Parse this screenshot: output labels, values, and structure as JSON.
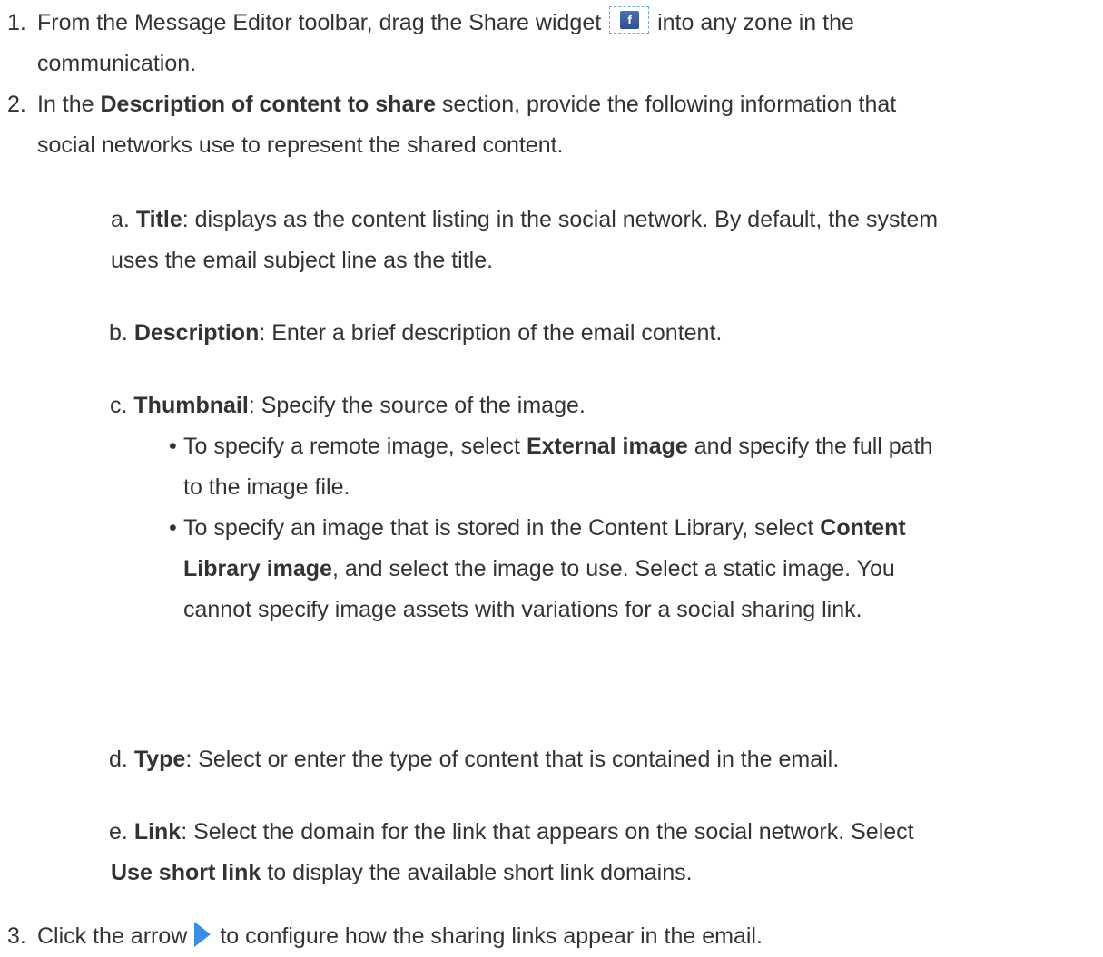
{
  "steps": [
    {
      "num": "1.",
      "pre": "From the Message Editor toolbar, drag the Share widget",
      "icon": "facebook-share-icon",
      "post": "into any zone in the",
      "line2": "communication."
    },
    {
      "num": "2.",
      "pre": "In the ",
      "bold": "Description of content to share",
      "post": " section, provide the following information that",
      "line2": "social networks use to represent the shared content."
    },
    {
      "num": "3.",
      "pre": "Click the arrow",
      "icon": "blue-arrow-icon",
      "post": "to configure how the sharing links appear in the email."
    }
  ],
  "subitems": [
    {
      "letter": "a.",
      "bold": "Title",
      "text": ": displays as the content listing in the social network. By default, the system",
      "line2": "uses the email subject line as the title."
    },
    {
      "letter": "b.",
      "bold": "Description",
      "text": ": Enter a brief description of the email content."
    },
    {
      "letter": "c.",
      "bold": "Thumbnail",
      "text": ": Specify the source of the image."
    },
    {
      "letter": "d.",
      "bold": "Type",
      "text": ": Select or enter the type of content that is contained in the email."
    },
    {
      "letter": "e.",
      "bold": "Link",
      "text": ": Select the domain for the link that appears on the social network. Select",
      "bold2": "Use short link",
      "text2": " to display the available short link domains."
    }
  ],
  "bullets": [
    {
      "pre": "To specify a remote image, select ",
      "bold": "External image",
      "post": " and specify the full path",
      "line2": "to the image file."
    },
    {
      "pre": "To specify an image that is stored in the Content Library, select ",
      "bold": "Content",
      "bold_l2": "Library image",
      "post_l2": ", and select the image to use. Select a static image. You",
      "line3": "cannot specify image assets with variations for a social sharing link."
    }
  ]
}
